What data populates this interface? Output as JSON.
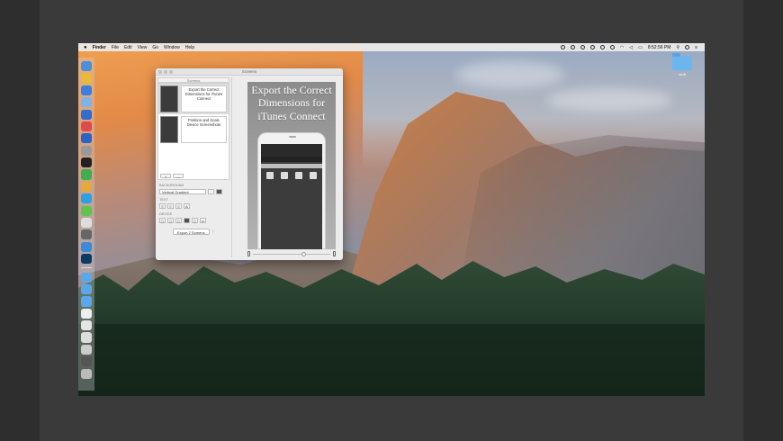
{
  "menubar": {
    "apple_icon": "",
    "items": [
      "Finder",
      "File",
      "Edit",
      "View",
      "Go",
      "Window",
      "Help"
    ],
    "clock": "8:52:56 PM"
  },
  "desktop": {
    "folder_label": "stuff"
  },
  "window": {
    "title": "Screens",
    "pane_header": "Screens",
    "screens": [
      {
        "caption": "Export the Correct Dimensions for iTunes Connect"
      },
      {
        "caption": "Position and Scale Device Screenshots"
      }
    ],
    "list_buttons": [
      "+",
      "—"
    ],
    "background_label": "BACKGROUND",
    "background_value": "Vertical Gradient",
    "text_label": "TEXT",
    "device_label": "DEVICE",
    "export_button": "Export 2 Screens",
    "preview_title": "Export the Correct Dimensions for iTunes Connect"
  }
}
